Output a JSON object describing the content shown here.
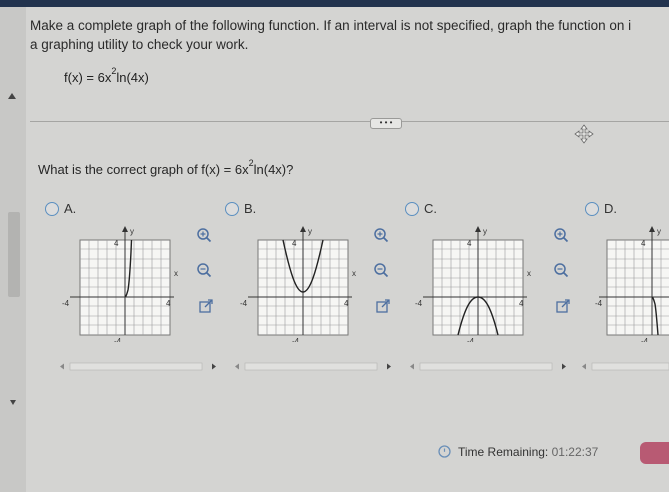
{
  "instructions": {
    "line1": "Make a complete graph of the following function. If an interval is not specified, graph the function on i",
    "line2": "a graphing utility to check your work."
  },
  "function": {
    "prefix": "f(x) = 6x",
    "exp": "2",
    "suffix": "ln(4x)"
  },
  "more_button": {
    "label": "• • •"
  },
  "question": {
    "prefix": "What is the correct graph of f(x) = 6x",
    "exp": "2",
    "suffix": "ln(4x)?"
  },
  "options": [
    {
      "label": "A."
    },
    {
      "label": "B."
    },
    {
      "label": "C."
    },
    {
      "label": "D."
    }
  ],
  "graph_labels": {
    "y": "y",
    "x": "x",
    "pos4": "4",
    "neg4": "-4"
  },
  "timer": {
    "label": "Time Remaining:",
    "value": "01:22:37"
  },
  "icons": [
    "zoom-in-icon",
    "zoom-out-icon",
    "external-link-icon",
    "move-icon",
    "clock-icon"
  ],
  "colors": {
    "accent": "#5b8fc0",
    "header": "#22334e",
    "timer_tab": "#b85a73"
  }
}
